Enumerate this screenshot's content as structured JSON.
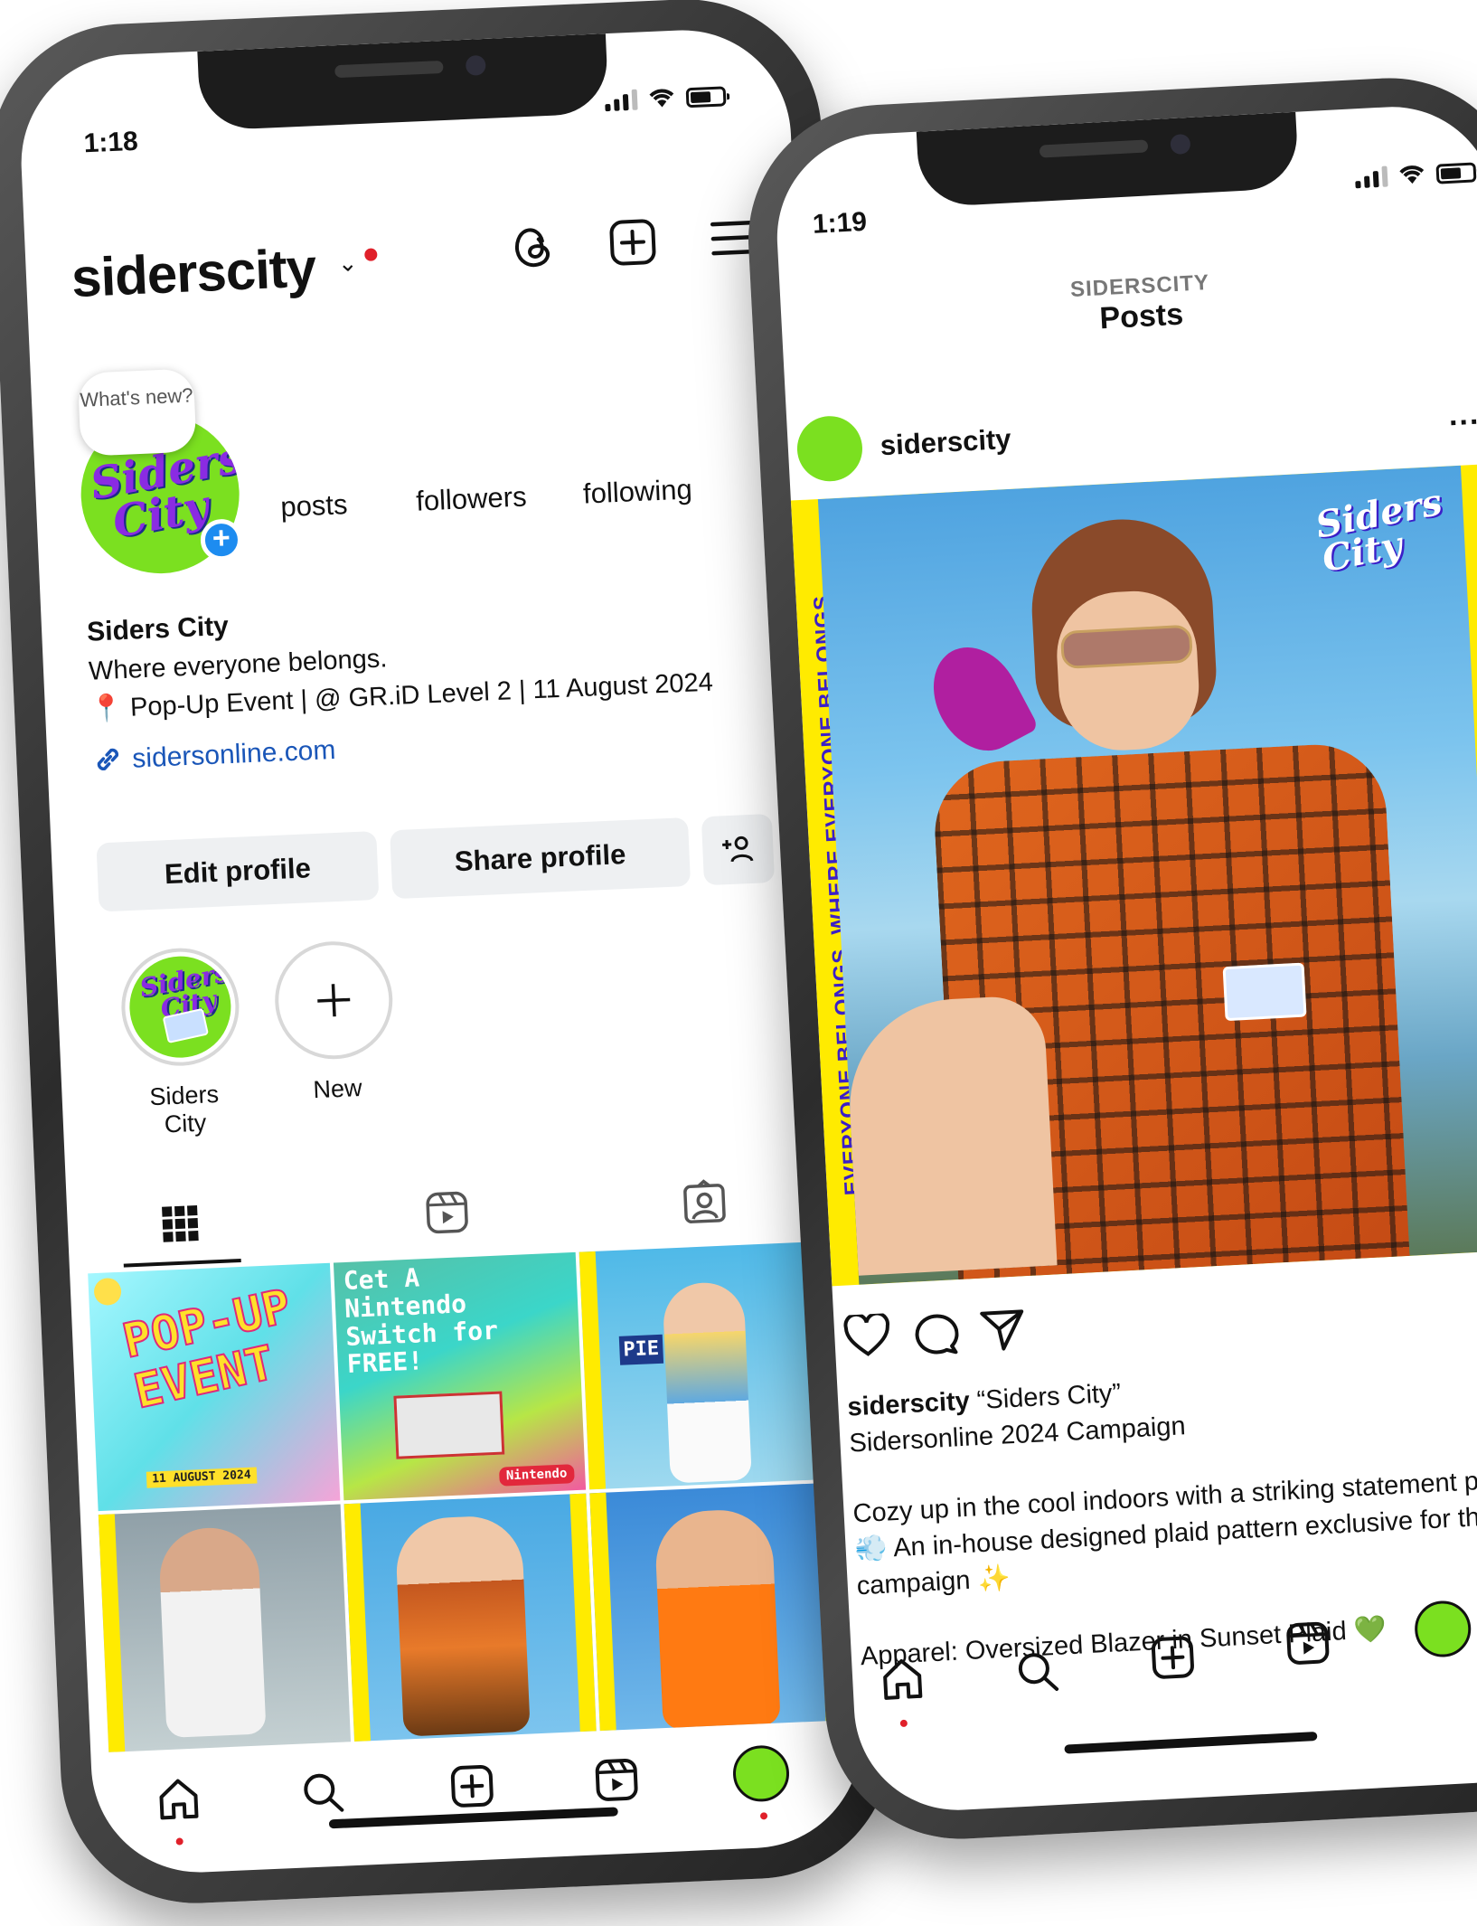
{
  "left": {
    "time": "1:18",
    "username": "siderscity",
    "whats_new": "What's new?",
    "stats": {
      "posts_label": "posts",
      "followers_label": "followers",
      "following_label": "following"
    },
    "display_name": "Siders City",
    "bio_line1": "Where everyone belongs.",
    "bio_line2": "📍 Pop-Up Event | @ GR.iD Level 2 | 11 August 2024",
    "link": "sidersonline.com",
    "buttons": {
      "edit": "Edit profile",
      "share": "Share profile"
    },
    "highlights": [
      {
        "label": "Siders City"
      },
      {
        "label": "New"
      }
    ],
    "grid": {
      "promo_text": "Cet A Nintendo Switch for FREE!",
      "popup_text": "POP-UP EVENT",
      "popup_date": "11 AUGUST 2024",
      "nintendo_tag": "Nintendo",
      "sign": "PIE",
      "repeat_text": "EVERYONE BELONGS. WHERE EVERYONE BELONGS."
    }
  },
  "right": {
    "time": "1:19",
    "header_sub": "SIDERSCITY",
    "header_title": "Posts",
    "username": "siderscity",
    "more": "...",
    "vertical_text": "EVERYONE BELONGS. WHERE EVERYONE BELONGS.",
    "caption": {
      "user": "siderscity",
      "line1_rest": "“Siders City”",
      "line2": "Sidersonline 2024 Campaign",
      "line3": "Cozy up in the cool indoors with a striking statement piece! 💨 An in-house designed plaid pattern exclusive for this campaign ✨",
      "line4": "Apparel: Oversized Blazer in Sunset Plaid 💚"
    }
  },
  "brand_logo_text": "Siders City",
  "colors": {
    "brand_green": "#7be020",
    "brand_purple": "#8a2be2",
    "link_blue": "#1a56b8",
    "accent_blue": "#1d8cf0",
    "notification_red": "#e0202a",
    "banner_yellow": "#ffeb00"
  },
  "icons": [
    "threads-icon",
    "plus-square-icon",
    "menu-icon",
    "link-icon",
    "add-person-icon",
    "grid-icon",
    "reels-icon",
    "tagged-icon",
    "home-icon",
    "search-icon",
    "heart-icon",
    "comment-icon",
    "share-icon",
    "bookmark-icon"
  ]
}
